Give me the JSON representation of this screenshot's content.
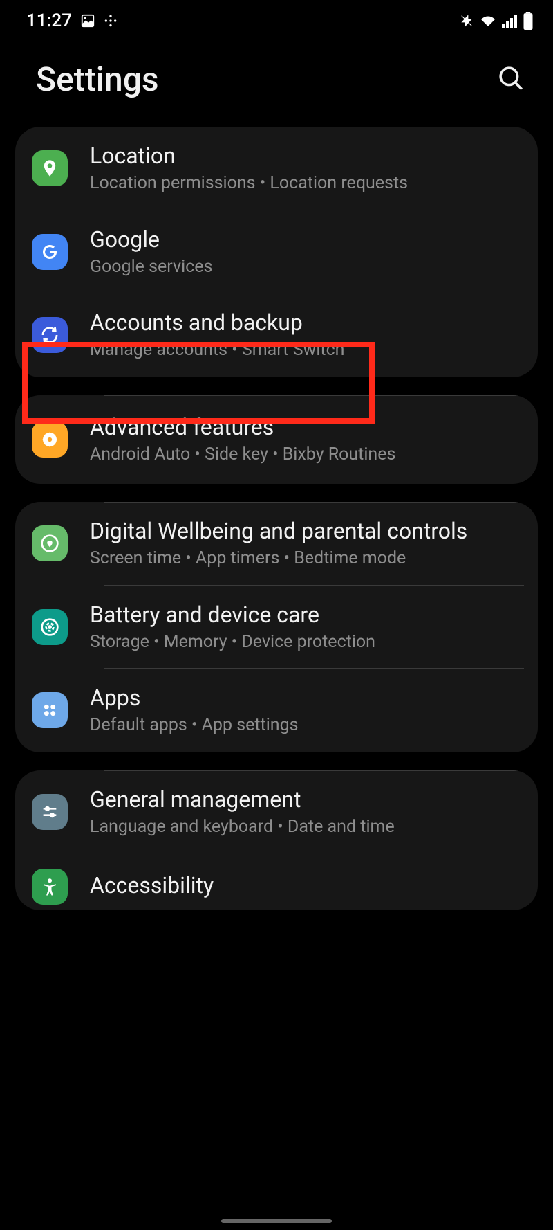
{
  "status": {
    "time": "11:27"
  },
  "header": {
    "title": "Settings"
  },
  "groups": [
    {
      "items": [
        {
          "id": "location",
          "title": "Location",
          "subtitle": "Location permissions  •  Location requests"
        },
        {
          "id": "google",
          "title": "Google",
          "subtitle": "Google services"
        },
        {
          "id": "accounts",
          "title": "Accounts and backup",
          "subtitle": "Manage accounts  •  Smart Switch"
        }
      ]
    },
    {
      "items": [
        {
          "id": "advanced",
          "title": "Advanced features",
          "subtitle": "Android Auto  •  Side key  •  Bixby Routines"
        }
      ]
    },
    {
      "items": [
        {
          "id": "wellbeing",
          "title": "Digital Wellbeing and parental controls",
          "subtitle": "Screen time  •  App timers  •  Bedtime mode"
        },
        {
          "id": "battery",
          "title": "Battery and device care",
          "subtitle": "Storage  •  Memory  •  Device protection"
        },
        {
          "id": "apps",
          "title": "Apps",
          "subtitle": "Default apps  •  App settings"
        }
      ]
    },
    {
      "items": [
        {
          "id": "general",
          "title": "General management",
          "subtitle": "Language and keyboard  •  Date and time"
        },
        {
          "id": "accessibility",
          "title": "Accessibility",
          "subtitle": ""
        }
      ]
    }
  ]
}
